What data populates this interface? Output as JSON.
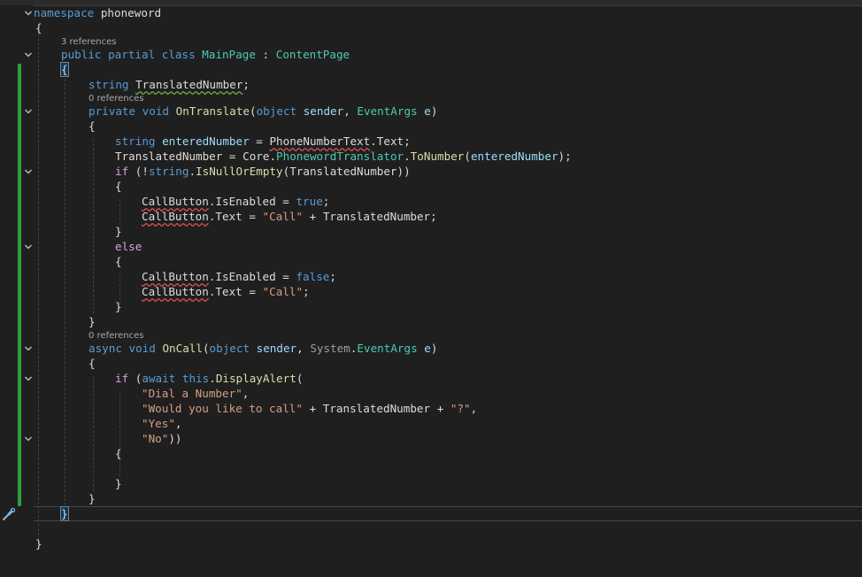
{
  "codelens": {
    "class_refs": "3 references",
    "translate_refs": "0 references",
    "oncall_refs": "0 references"
  },
  "code": {
    "kw_namespace": "namespace",
    "ns_name": "phoneword",
    "brace_open": "{",
    "brace_close": "}",
    "kw_public": "public",
    "kw_partial": "partial",
    "kw_class": "class",
    "class_name": "MainPage",
    "colon": ":",
    "base_class": "ContentPage",
    "kw_string": "string",
    "field_name": "TranslatedNumber",
    "semicolon": ";",
    "kw_private": "private",
    "kw_void": "void",
    "m_translate": "OnTranslate",
    "paren_open": "(",
    "kw_object": "object",
    "p_sender": "sender",
    "comma": ",",
    "t_eventargs": "EventArgs",
    "p_e": "e",
    "paren_close_sig": ")",
    "v_entered": "enteredNumber",
    "eq": "=",
    "phone_text": "PhoneNumberText",
    "dot": ".",
    "text_prop": "Text",
    "core": "Core",
    "translator": "PhonewordTranslator",
    "to_number": "ToNumber",
    "if_kw": "if",
    "not_op": "(!",
    "is_null": "IsNullOrEmpty",
    "close2": "))",
    "call_button": "CallButton",
    "is_enabled": "IsEnabled",
    "kw_true": "true",
    "kw_false": "false",
    "str_call": "\"Call\"",
    "plus": "+",
    "else_kw": "else",
    "kw_async": "async",
    "m_oncall": "OnCall",
    "system": "System",
    "kw_await": "await",
    "kw_this": "this",
    "display_alert": "DisplayAlert",
    "str_dial": "\"Dial a Number\"",
    "str_like": "\"Would you like to call\"",
    "str_q": "\"?\"",
    "str_yes": "\"Yes\"",
    "str_no": "\"No\"",
    "close_call": "))"
  }
}
